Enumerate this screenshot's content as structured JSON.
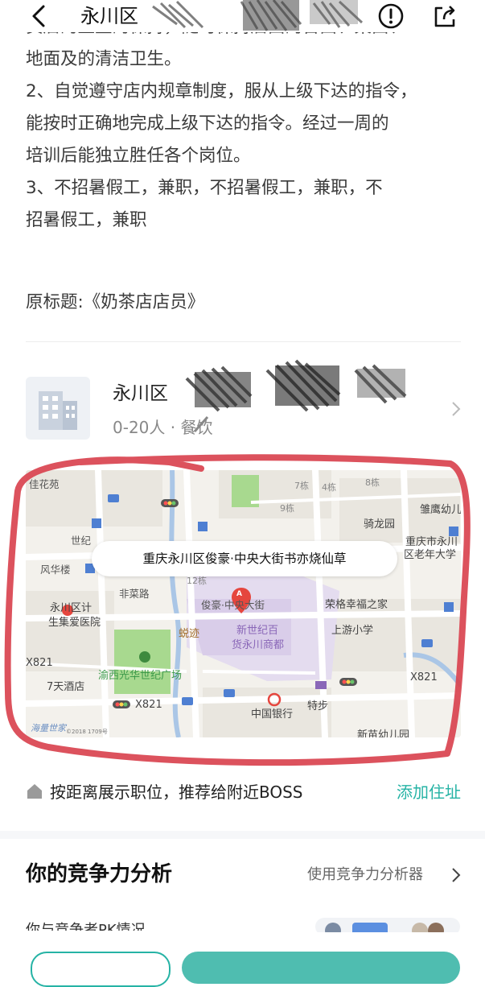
{
  "header": {
    "title": "永川区"
  },
  "description": {
    "cut_line": "员店的卫生的保持，随时保持店面的台面、桌面、",
    "lines": [
      "地面及的清洁卫生。",
      "2、自觉遵守店内规章制度，服从上级下达的指令，",
      "能按时正确地完成上级下达的指令。经过一周的",
      "培训后能独立胜任各个岗位。",
      "3、不招暑假工，兼职，不招暑假工，兼职，不",
      "招暑假工，兼职"
    ],
    "original_title": "原标题:《奶茶店店员》"
  },
  "company": {
    "name": "永川区",
    "meta": "0-20人 · 餐饮"
  },
  "map": {
    "callout": "重庆永川区俊豪·中央大街书亦烧仙草",
    "marker": "A",
    "labels": {
      "l1": "佳花苑",
      "l2": "7栋",
      "l3": "4栋",
      "l4": "8栋",
      "l5": "9栋",
      "l6": "雏鹰幼儿",
      "l7": "骑龙园",
      "l8": "重庆市永川",
      "l9": "区老年大学",
      "l10": "世纪",
      "l11": "风华楼",
      "l12": "12栋",
      "l13": "非菜路",
      "l14": "俊豪·中央大街",
      "l15": "荣格幸福之家",
      "l16": "永川区计",
      "l17": "生集爱医院",
      "l18": "蜕迹",
      "l19": "新世纪百",
      "l20": "货永川商都",
      "l21": "上游小学",
      "l22": "X821",
      "l23": "X821",
      "l24": "渝西光华世纪广场",
      "l25": "7天酒店",
      "l26": "X821",
      "l27": "中国银行",
      "l28": "特步",
      "l29": "新苗幼儿园"
    },
    "logo": "海量世家",
    "copyright": "©2018 1709号"
  },
  "address": {
    "hint": "按距离展示职位，推荐给附近BOSS",
    "add_label": "添加住址"
  },
  "competitiveness": {
    "title": "你的竞争力分析",
    "link": "使用竞争力分析器",
    "subtitle": "你与竞争者PK情况"
  },
  "colors": {
    "accent": "#26b3a5",
    "annotation": "#d9434f",
    "poi_purple": "#8a67b8",
    "park_green": "#a8d98f"
  }
}
